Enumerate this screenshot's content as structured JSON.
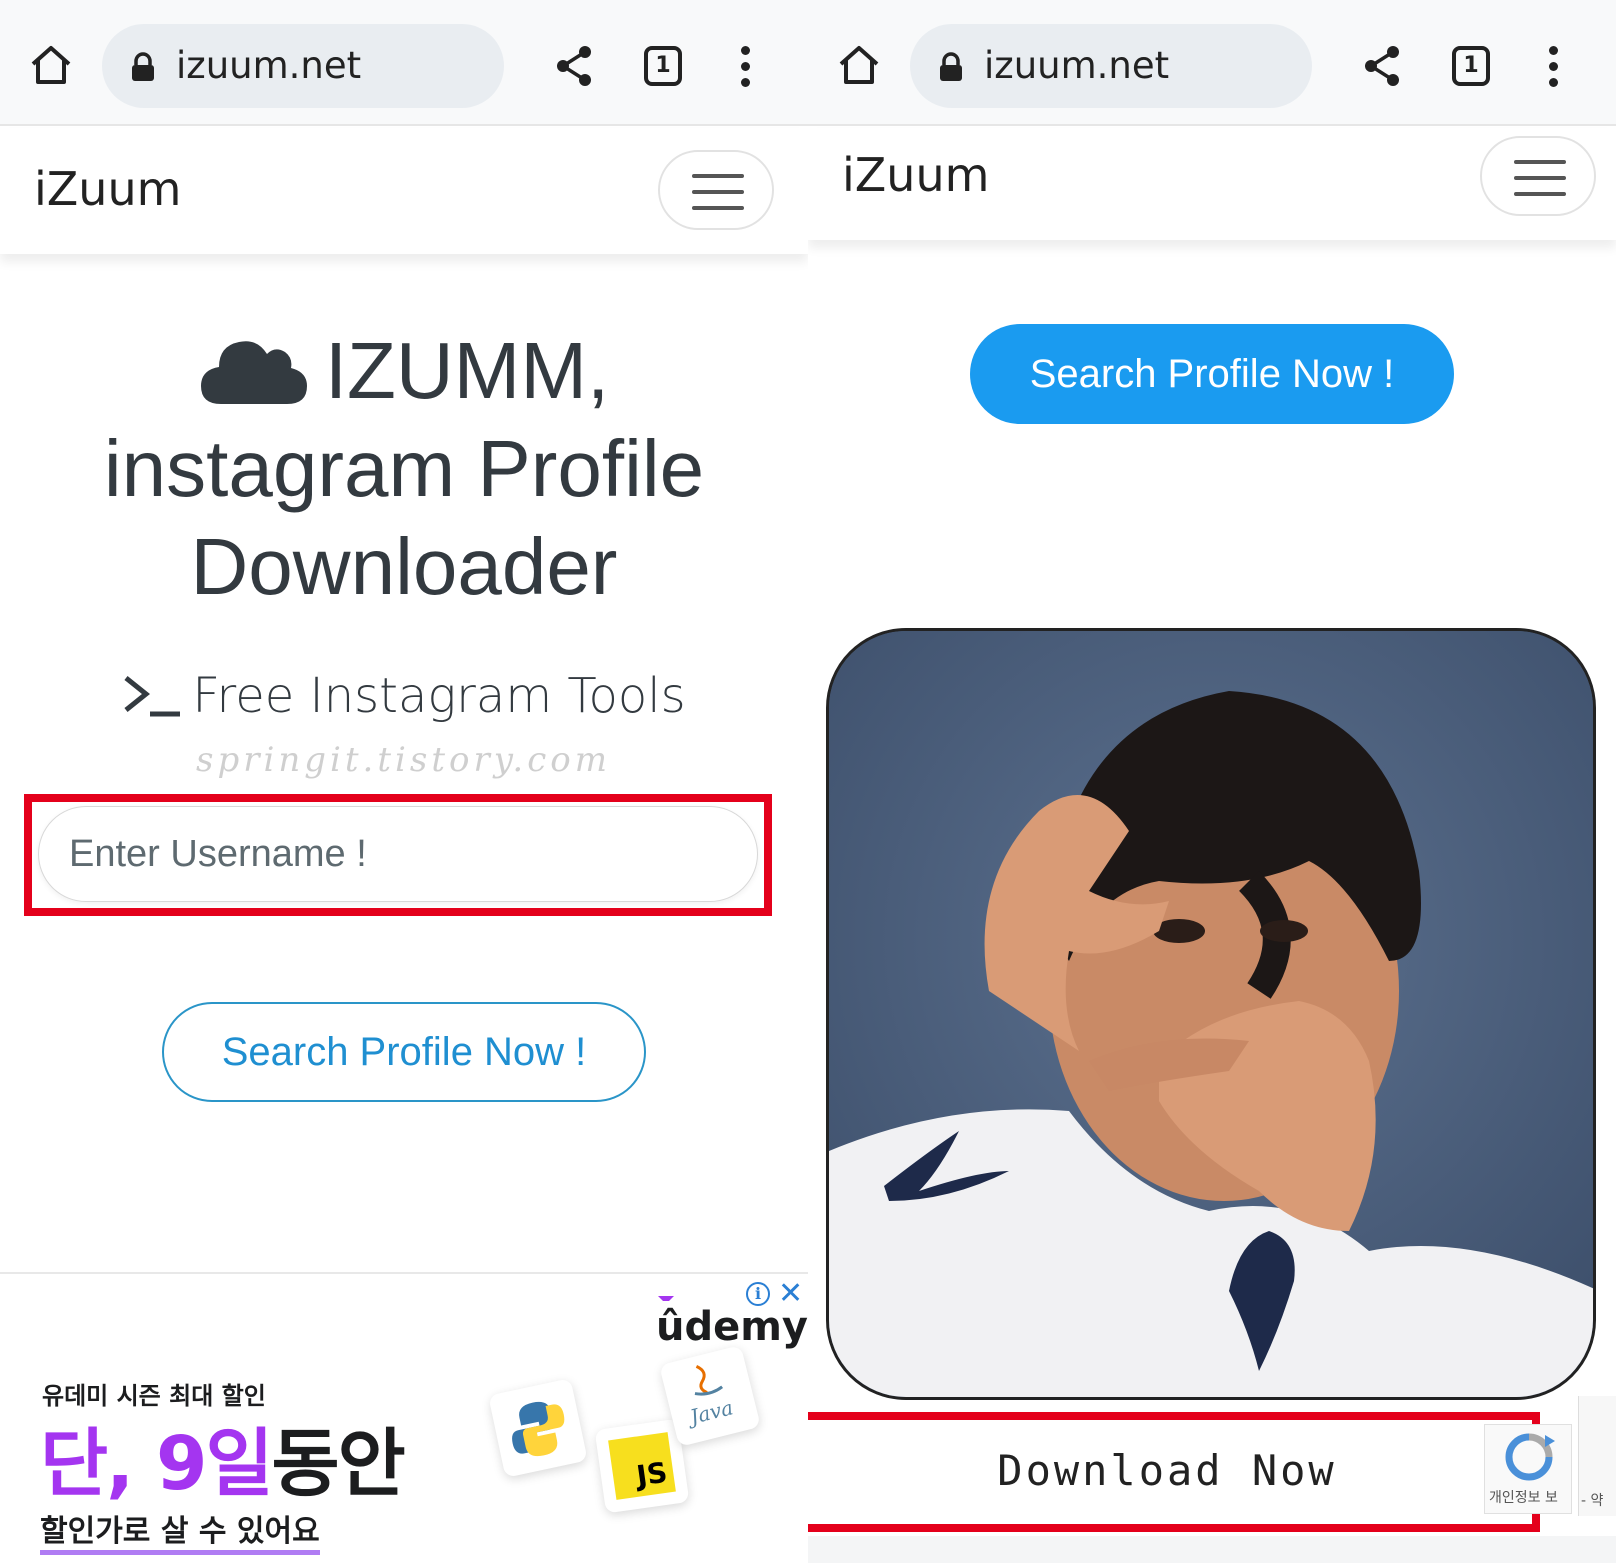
{
  "left": {
    "browser": {
      "url": "izuum.net",
      "tab_count": "1"
    },
    "navbar": {
      "brand": "iZuum"
    },
    "hero": {
      "title_line1": "IZUMM,",
      "title_line2": "instagram Profile",
      "title_line3": "Downloader",
      "subtitle": "Free Instagram Tools",
      "watermark": "springit.tistory.com"
    },
    "search": {
      "input_placeholder": "Enter Username !",
      "button_label": "Search Profile Now !"
    },
    "ad": {
      "brand": "ûdemy",
      "tagline": "유데미 시즌 최대 할인",
      "headline_purple": "단, 9일",
      "headline_dark": "동안",
      "bottom_text": "할인가로 살 수 있어요",
      "icons": [
        "python-icon",
        "js-icon",
        "java-icon"
      ],
      "js_label": "JS",
      "java_label": "Java"
    }
  },
  "right": {
    "browser": {
      "url": "izuum.net",
      "tab_count": "1"
    },
    "navbar": {
      "brand": "iZuum"
    },
    "search_button_label": "Search Profile Now !",
    "profile_image": "profile-photo",
    "download_label": "Download Now",
    "recaptcha_text": "개인정보 보",
    "recaptcha_side_text": "- 약"
  },
  "colors": {
    "highlight_red": "#e4001b",
    "button_blue": "#1a9bf0",
    "outline_blue": "#2a95c8",
    "udemy_purple": "#a435f0",
    "text_dark": "#333a40"
  }
}
